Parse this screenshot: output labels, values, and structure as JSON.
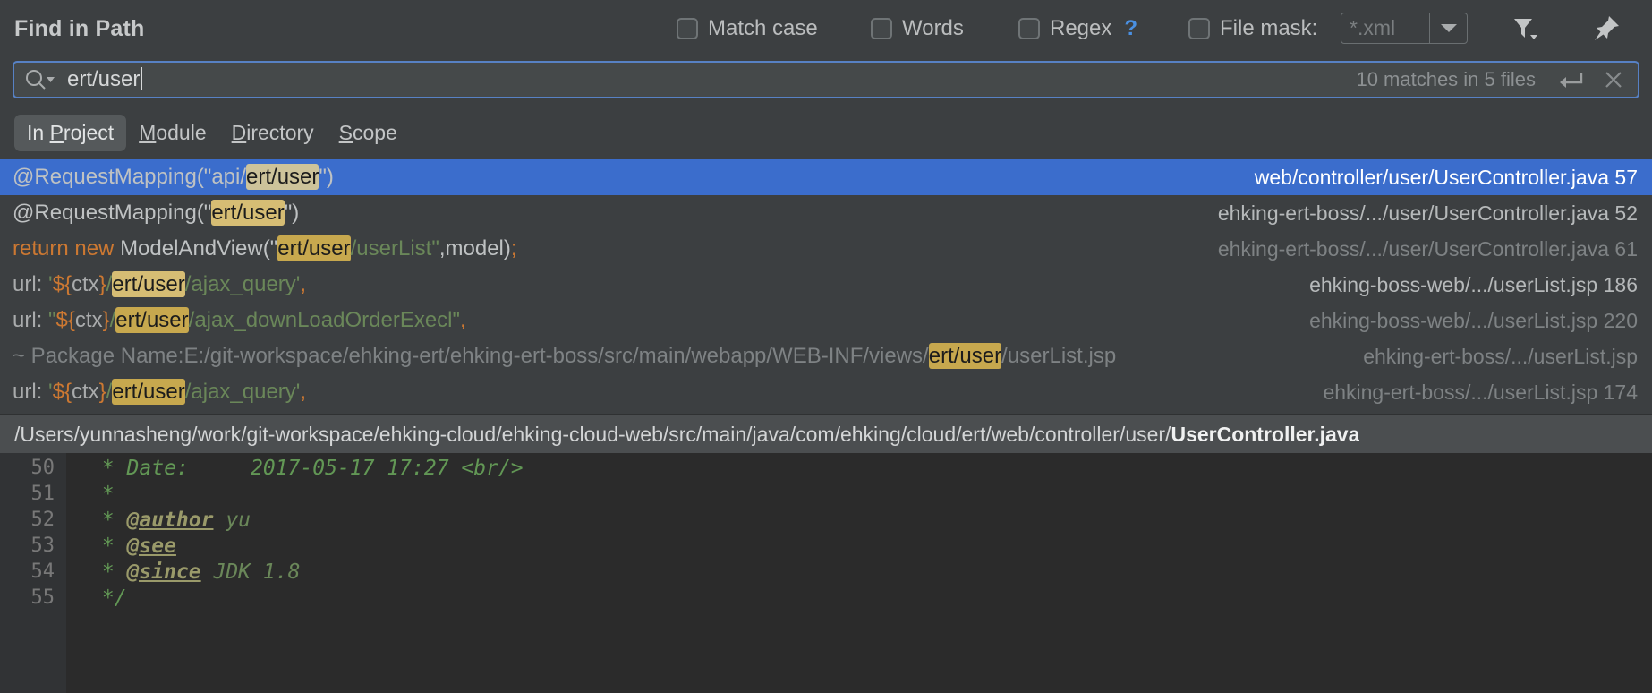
{
  "header": {
    "title": "Find in Path",
    "options": [
      {
        "label": "Match case",
        "checked": false
      },
      {
        "label": "Words",
        "checked": false
      },
      {
        "label": "Regex",
        "checked": false,
        "help": "?"
      },
      {
        "label": "File mask:",
        "checked": false
      }
    ],
    "file_mask_value": "*.xml",
    "icons": {
      "filter": "filter-icon",
      "pin": "pin-icon",
      "dropdown": "chevron-down-icon"
    }
  },
  "search": {
    "value": "ert/user",
    "placeholder": "",
    "match_summary": "10 matches in 5 files",
    "icons": {
      "search": "search-icon",
      "enter": "enter-arrow-icon",
      "close": "close-icon"
    }
  },
  "scope_tabs": [
    {
      "pre": "In ",
      "mnemonic": "P",
      "post": "roject",
      "selected": true
    },
    {
      "pre": "",
      "mnemonic": "M",
      "post": "odule",
      "selected": false
    },
    {
      "pre": "",
      "mnemonic": "D",
      "post": "irectory",
      "selected": false
    },
    {
      "pre": "",
      "mnemonic": "S",
      "post": "cope",
      "selected": false
    }
  ],
  "results": [
    {
      "selected": true,
      "dim": false,
      "path": "web/controller/user/UserController.java 57",
      "tokens": [
        {
          "text": "@RequestMapping(\"api/",
          "cls": "t-def"
        },
        {
          "text": "ert/user",
          "cls": "hl"
        },
        {
          "text": "\")",
          "cls": "t-def"
        }
      ]
    },
    {
      "selected": false,
      "dim": false,
      "path": "ehking-ert-boss/.../user/UserController.java 52",
      "tokens": [
        {
          "text": "@RequestMapping(\"",
          "cls": "t-def"
        },
        {
          "text": "ert/user",
          "cls": "hl"
        },
        {
          "text": "\")",
          "cls": "t-def"
        }
      ]
    },
    {
      "selected": false,
      "dim": true,
      "path": "ehking-ert-boss/.../user/UserController.java 61",
      "tokens": [
        {
          "text": "return new ",
          "cls": "t-kw"
        },
        {
          "text": "ModelAndView(\"",
          "cls": "t-def"
        },
        {
          "text": "ert/user",
          "cls": "hl"
        },
        {
          "text": "/userList\"",
          "cls": "t-str"
        },
        {
          "text": ",model)",
          "cls": "t-def"
        },
        {
          "text": ";",
          "cls": "t-kw"
        }
      ]
    },
    {
      "selected": false,
      "dim": false,
      "path": "ehking-boss-web/.../userList.jsp 186",
      "tokens": [
        {
          "text": "url: ",
          "cls": "t-gray"
        },
        {
          "text": "'",
          "cls": "t-str"
        },
        {
          "text": "${",
          "cls": "t-kw"
        },
        {
          "text": "ctx",
          "cls": "t-gray"
        },
        {
          "text": "}",
          "cls": "t-kw"
        },
        {
          "text": "/",
          "cls": "t-str"
        },
        {
          "text": "ert/user",
          "cls": "hl"
        },
        {
          "text": "/ajax_query'",
          "cls": "t-str"
        },
        {
          "text": ",",
          "cls": "t-kw"
        }
      ]
    },
    {
      "selected": false,
      "dim": true,
      "path": "ehking-boss-web/.../userList.jsp 220",
      "tokens": [
        {
          "text": "url: ",
          "cls": "t-gray"
        },
        {
          "text": "\"",
          "cls": "t-str"
        },
        {
          "text": "${",
          "cls": "t-kw"
        },
        {
          "text": "ctx",
          "cls": "t-gray"
        },
        {
          "text": "}",
          "cls": "t-kw"
        },
        {
          "text": "/",
          "cls": "t-str"
        },
        {
          "text": "ert/user",
          "cls": "hl"
        },
        {
          "text": "/ajax_downLoadOrderExecl\"",
          "cls": "t-str"
        },
        {
          "text": ",",
          "cls": "t-kw"
        }
      ]
    },
    {
      "selected": false,
      "dim": true,
      "path": "ehking-ert-boss/.../userList.jsp",
      "tokens": [
        {
          "text": "  ~ Package Name:E:/git-workspace/ehking-ert/ehking-ert-boss/src/main/webapp/WEB-INF/views/",
          "cls": "t-dim"
        },
        {
          "text": "ert/user",
          "cls": "hl"
        },
        {
          "text": "/userList.jsp",
          "cls": "t-dim"
        }
      ]
    },
    {
      "selected": false,
      "dim": true,
      "path": "ehking-ert-boss/.../userList.jsp 174",
      "tokens": [
        {
          "text": "url: ",
          "cls": "t-gray"
        },
        {
          "text": "'",
          "cls": "t-str"
        },
        {
          "text": "${",
          "cls": "t-kw"
        },
        {
          "text": "ctx",
          "cls": "t-gray"
        },
        {
          "text": "}",
          "cls": "t-kw"
        },
        {
          "text": "/",
          "cls": "t-str"
        },
        {
          "text": "ert/user",
          "cls": "hl"
        },
        {
          "text": "/ajax_query'",
          "cls": "t-str"
        },
        {
          "text": ",",
          "cls": "t-kw"
        }
      ]
    }
  ],
  "status": {
    "path_prefix": "/Users/yunnasheng/work/git-workspace/ehking-cloud/ehking-cloud-web/src/main/java/com/ehking/cloud/ert/web/controller/user/",
    "file_name": "UserController.java"
  },
  "preview": {
    "lines": [
      {
        "num": "50",
        "segments": [
          {
            "text": " * Date:     2017-05-17 17:27 <br/>",
            "cls": "cplain"
          }
        ]
      },
      {
        "num": "51",
        "segments": [
          {
            "text": " *",
            "cls": "cplain"
          }
        ]
      },
      {
        "num": "52",
        "segments": [
          {
            "text": " * ",
            "cls": "cplain"
          },
          {
            "text": "@author",
            "cls": "ctag"
          },
          {
            "text": " yu",
            "cls": "cval"
          }
        ]
      },
      {
        "num": "53",
        "segments": [
          {
            "text": " * ",
            "cls": "cplain"
          },
          {
            "text": "@see",
            "cls": "ctag"
          }
        ]
      },
      {
        "num": "54",
        "segments": [
          {
            "text": " * ",
            "cls": "cplain"
          },
          {
            "text": "@since",
            "cls": "ctag"
          },
          {
            "text": " JDK 1.8",
            "cls": "cval"
          }
        ]
      },
      {
        "num": "55",
        "segments": [
          {
            "text": " */",
            "cls": "cplain"
          }
        ]
      }
    ]
  },
  "colors": {
    "accent_selection": "#3b6dcc",
    "highlight": "#d6bd74",
    "panel_bg": "#3c3f41",
    "editor_bg": "#2b2b2b",
    "focus_border": "#5781c4",
    "link_blue": "#4a90e2"
  }
}
